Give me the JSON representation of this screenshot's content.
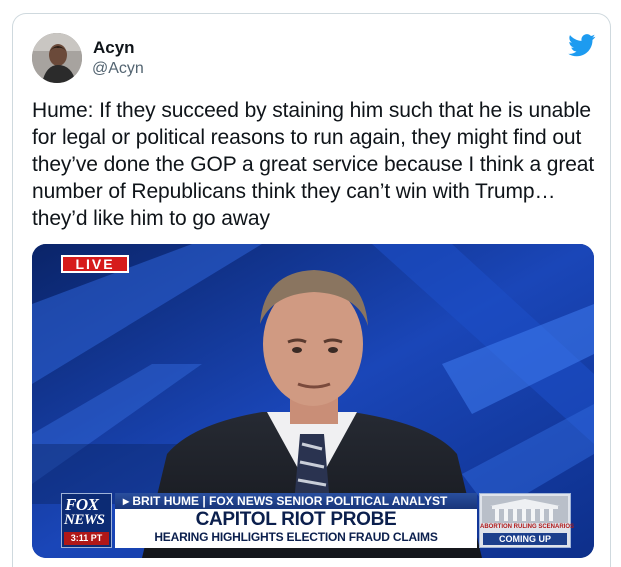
{
  "tweet": {
    "author_name": "Acyn",
    "author_handle": "@Acyn",
    "text": "Hume: If they succeed by staining him such that he is unable for legal or political reasons to run again, they might find out they’ve done the GOP a great service because I think a great number of Republicans think they can’t win with Trump… they’d like him to go away"
  },
  "video": {
    "live_badge": "LIVE",
    "network_line1": "FOX",
    "network_line2": "NEWS",
    "clock": "3:11 PT",
    "lower_third_top": "▸ BRIT HUME  |  FOX NEWS SENIOR POLITICAL ANALYST",
    "headline": "CAPITOL RIOT PROBE",
    "subheadline": "HEARING HIGHLIGHTS ELECTION FRAUD CLAIMS",
    "promo_caption": "ABORTION RULING SCENARIOS",
    "promo_coming": "COMING UP"
  },
  "icons": {
    "brand": "twitter-bird-icon"
  },
  "colors": {
    "twitter_blue": "#1d9bf0",
    "text": "#0f1419",
    "handle": "#536471",
    "live_red": "#d61b1b",
    "fox_navy": "#0c2b74"
  }
}
